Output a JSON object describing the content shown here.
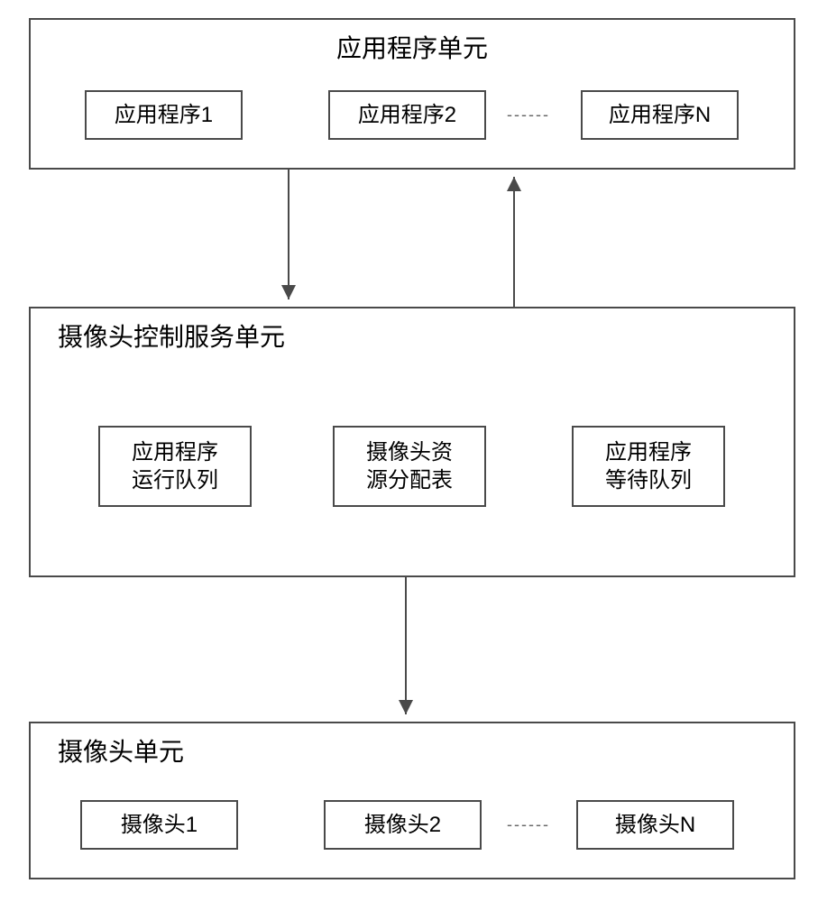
{
  "box1": {
    "title": "应用程序单元",
    "items": [
      "应用程序1",
      "应用程序2",
      "应用程序N"
    ],
    "ellipsis": "------"
  },
  "box2": {
    "title": "摄像头控制服务单元",
    "items": [
      "应用程序\n运行队列",
      "摄像头资\n源分配表",
      "应用程序\n等待队列"
    ]
  },
  "box3": {
    "title": "摄像头单元",
    "items": [
      "摄像头1",
      "摄像头2",
      "摄像头N"
    ],
    "ellipsis": "------"
  }
}
